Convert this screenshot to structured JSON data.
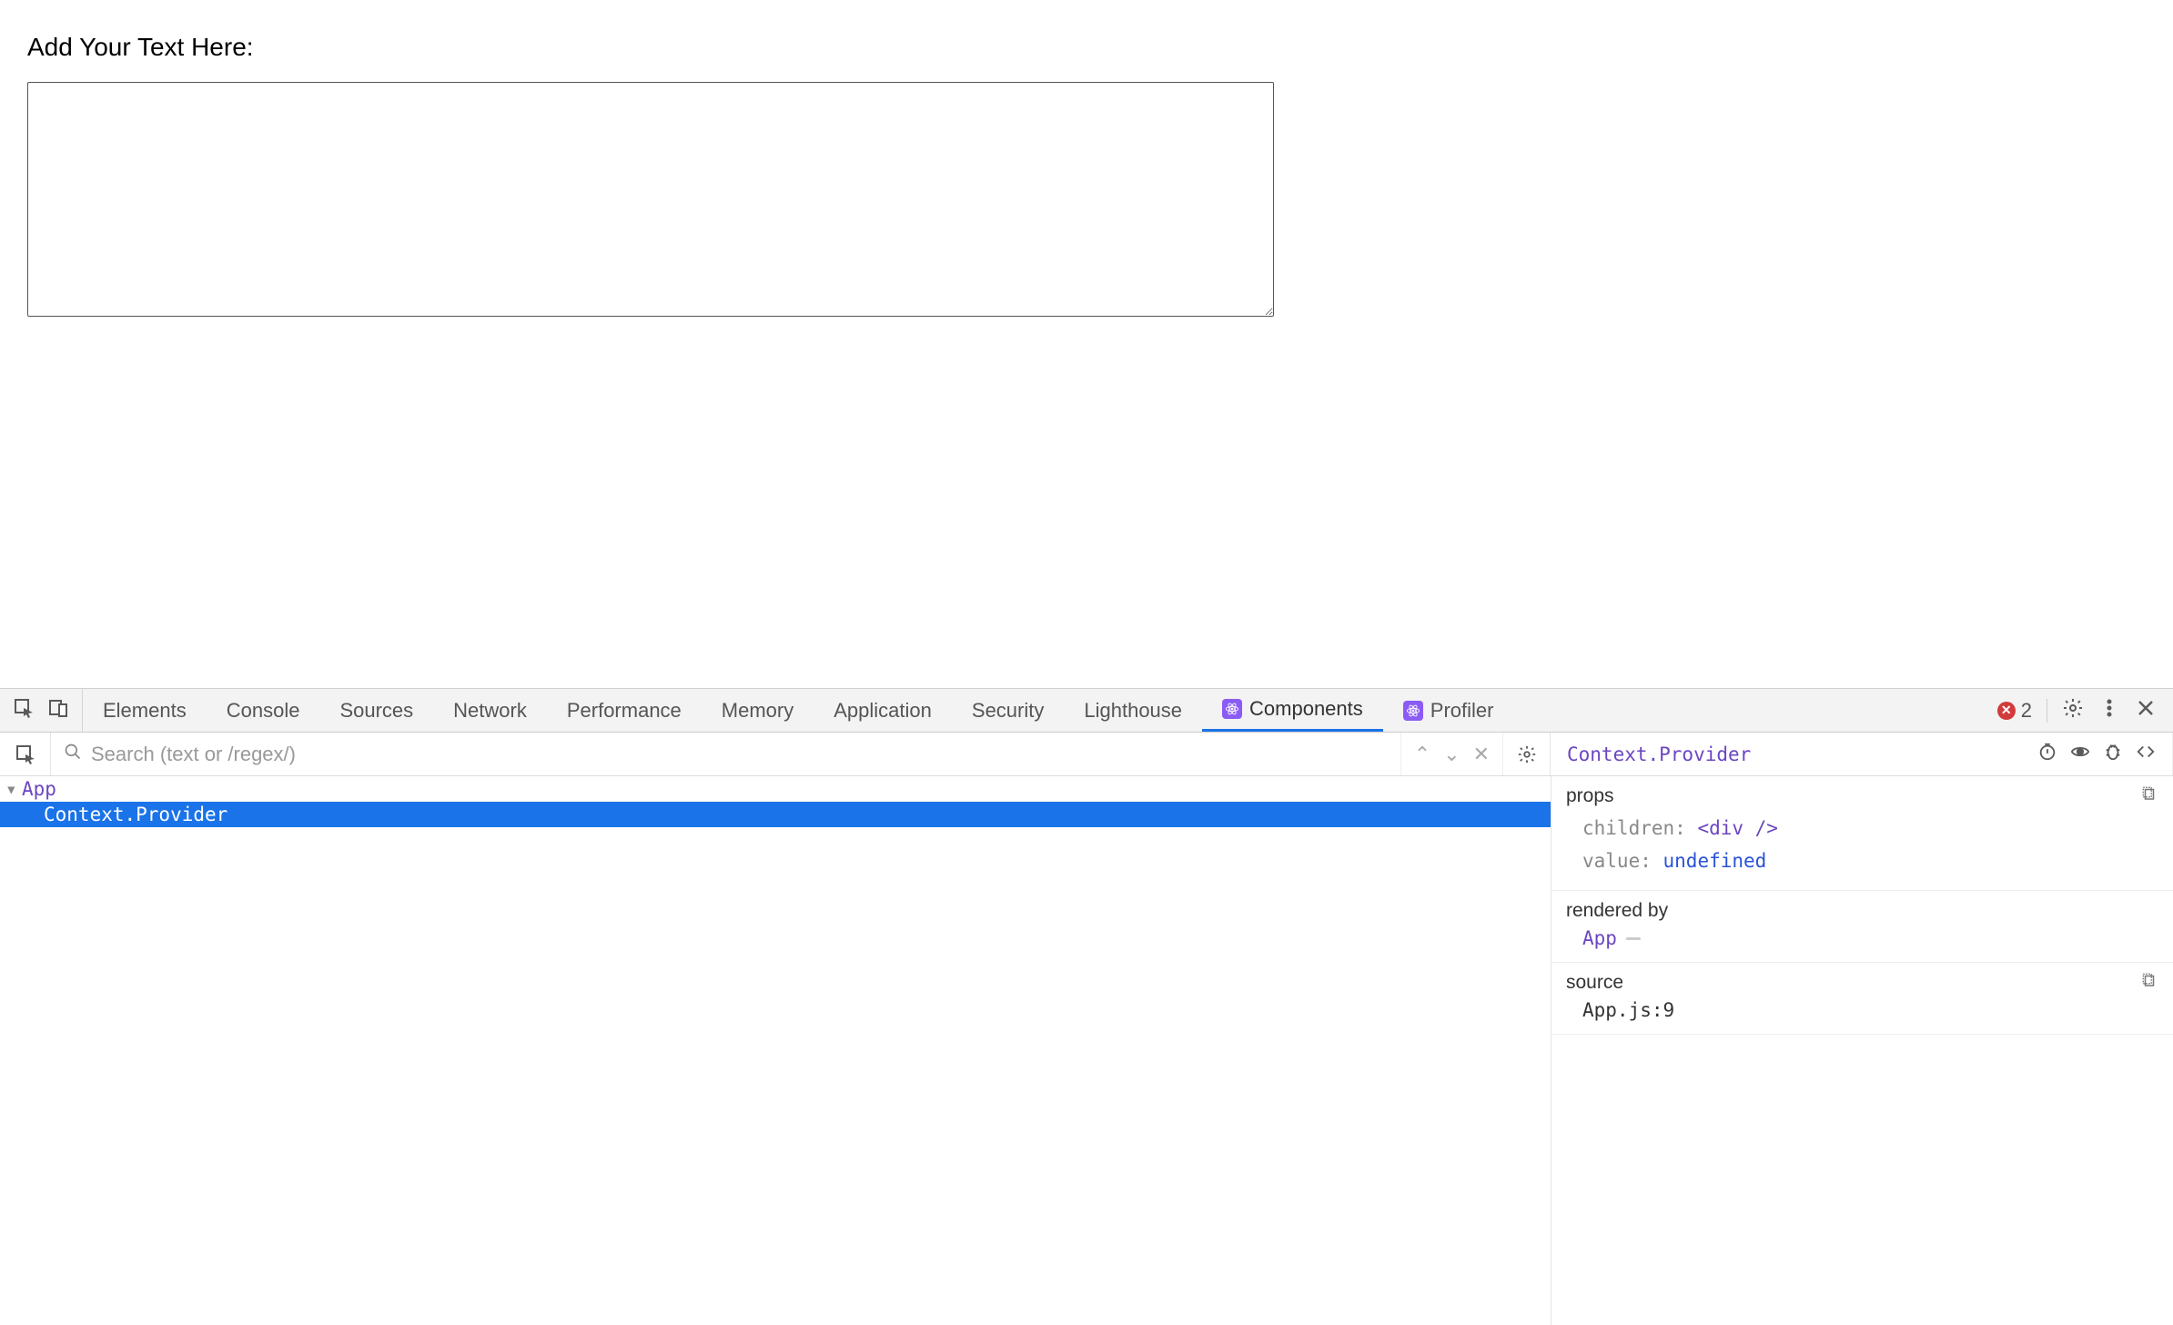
{
  "page": {
    "label": "Add Your Text Here:",
    "textarea_value": ""
  },
  "devtools": {
    "tabs": {
      "elements": "Elements",
      "console": "Console",
      "sources": "Sources",
      "network": "Network",
      "performance": "Performance",
      "memory": "Memory",
      "application": "Application",
      "security": "Security",
      "lighthouse": "Lighthouse",
      "components": "Components",
      "profiler": "Profiler"
    },
    "error_count": "2"
  },
  "react": {
    "search_placeholder": "Search (text or /regex/)",
    "selected_title": "Context.Provider",
    "tree": {
      "root": "App",
      "child": "Context.Provider"
    },
    "details": {
      "props_label": "props",
      "children_key": "children",
      "children_val": "<div />",
      "value_key": "value",
      "value_val": "undefined",
      "rendered_by_label": "rendered by",
      "rendered_by_val": "App",
      "source_label": "source",
      "source_val": "App.js:9"
    }
  }
}
